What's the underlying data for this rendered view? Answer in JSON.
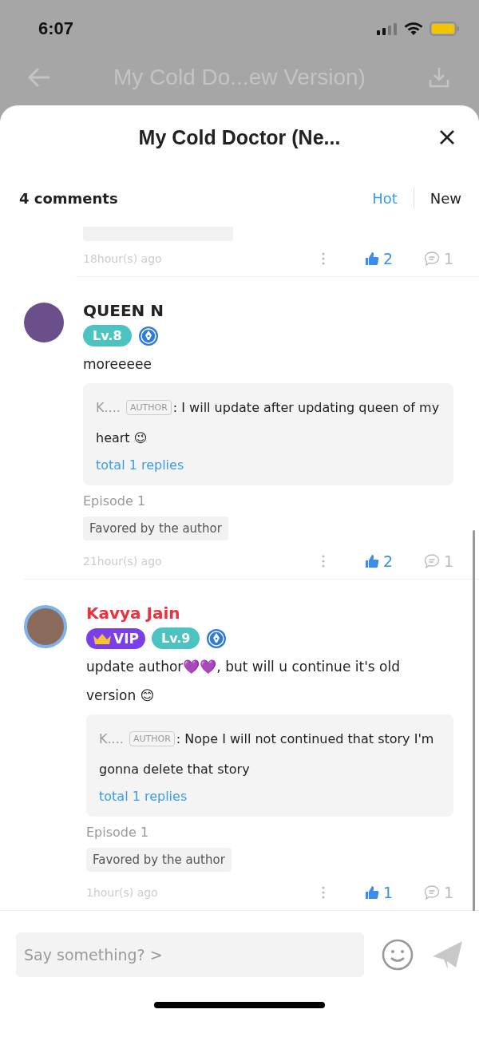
{
  "status_bar": {
    "time": "6:07"
  },
  "background_header": {
    "title": "My Cold Do...ew Version)"
  },
  "sheet": {
    "title": "My Cold Doctor (Ne..."
  },
  "comments_header": {
    "count": "4 comments",
    "sort_tabs": [
      {
        "label": "Hot",
        "selected": true
      },
      {
        "label": "New",
        "selected": false
      }
    ]
  },
  "partial_comment": {
    "time": "18hour(s) ago",
    "likes": "2",
    "replies": "1"
  },
  "comments": [
    {
      "name": "QUEEN N",
      "color": "#222222",
      "badges": [
        {
          "kind": "level",
          "label": "Lv.8"
        },
        {
          "kind": "medal"
        }
      ],
      "text": "moreeeee",
      "reply": {
        "name": "K....",
        "badge": "AUTHOR",
        "text": ": I will update after updating queen of my heart 😉",
        "link": "total 1 replies"
      },
      "episode": "Episode 1",
      "tag": "Favored by the author",
      "time": "21hour(s) ago",
      "likes": "2",
      "replies": "1",
      "framed": false
    },
    {
      "name": "Kavya Jain",
      "color": "#e8343f",
      "badges": [
        {
          "kind": "vip",
          "label": "VIP"
        },
        {
          "kind": "level",
          "label": "Lv.9"
        },
        {
          "kind": "medal"
        }
      ],
      "text": "update author💜💜, but will u continue it's old version 😊",
      "reply": {
        "name": "K....",
        "badge": "AUTHOR",
        "text": ": Nope I will not continued that story I'm gonna delete that story",
        "link": "total 1 replies"
      },
      "episode": "Episode 1",
      "tag": "Favored by the author",
      "time": "1hour(s) ago",
      "likes": "1",
      "replies": "1",
      "framed": true
    }
  ],
  "composer": {
    "placeholder": "Say something? >"
  }
}
